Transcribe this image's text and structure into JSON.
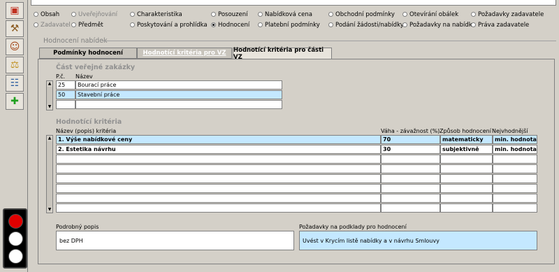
{
  "radios": {
    "row1": [
      {
        "label": "Obsah",
        "style": "normal"
      },
      {
        "label": "Uveřejňování",
        "style": "gray"
      },
      {
        "label": "Charakteristika",
        "style": "normal"
      },
      {
        "label": "Posouzení",
        "style": "normal"
      },
      {
        "label": "Nabídková cena",
        "style": "normal"
      },
      {
        "label": "Obchodní podmínky",
        "style": "normal"
      },
      {
        "label": "Otevírání obálek",
        "style": "normal"
      },
      {
        "label": "Požadavky zadavatele",
        "style": "normal"
      }
    ],
    "row2": [
      {
        "label": "Zadavatel",
        "style": "gray"
      },
      {
        "label": "Předmět",
        "style": "normal"
      },
      {
        "label": "Poskytování a prohlídka",
        "style": "normal"
      },
      {
        "label": "Hodnocení",
        "style": "selected"
      },
      {
        "label": "Platební podmínky",
        "style": "normal"
      },
      {
        "label": "Podání žádosti/nabídky",
        "style": "normal"
      },
      {
        "label": "Požadavky na nabídku",
        "style": "normal"
      },
      {
        "label": "Práva zadavatele",
        "style": "normal"
      }
    ]
  },
  "section_title": "Hodnocení nabídek",
  "tabs": [
    "Podmínky hodnocení",
    "Hodnotící kritéria pro VZ",
    "Hodnotící kritéria pro části VZ"
  ],
  "parts": {
    "title": "Část veřejné zakázky",
    "col_pc": "P.č.",
    "col_name": "Název",
    "rows": [
      {
        "pc": "25",
        "name": "Bourací práce"
      },
      {
        "pc": "50",
        "name": "Stavební práce"
      },
      {
        "pc": "",
        "name": ""
      }
    ]
  },
  "criteria": {
    "title": "Hodnotící kritéria",
    "col_name": "Název (popis) kritéria",
    "col_weight": "Váha - závažnost (%)",
    "col_method": "Způsob hodnocení",
    "col_best": "Nejvhodnější",
    "rows": [
      {
        "name": "1.  Výše nabídkové ceny",
        "weight": "70",
        "method": "matematicky",
        "best": "min. hodnota"
      },
      {
        "name": "2.  Estetika návrhu",
        "weight": "30",
        "method": "subjektivně",
        "best": "min. hodnota"
      },
      {
        "name": "",
        "weight": "",
        "method": "",
        "best": ""
      },
      {
        "name": "",
        "weight": "",
        "method": "",
        "best": ""
      },
      {
        "name": "",
        "weight": "",
        "method": "",
        "best": ""
      },
      {
        "name": "",
        "weight": "",
        "method": "",
        "best": ""
      },
      {
        "name": "",
        "weight": "",
        "method": "",
        "best": ""
      },
      {
        "name": "",
        "weight": "",
        "method": "",
        "best": ""
      }
    ]
  },
  "detail": {
    "label": "Podrobný popis",
    "value": "bez DPH"
  },
  "requirements": {
    "label": "Požadavky na podklady pro hodnocení",
    "value": "Uvést v Krycím listě nabídky a v návrhu Smlouvy"
  },
  "sidebar_icons": [
    "briefcase-icon",
    "hammer-icon",
    "person-icon",
    "scales-icon",
    "document-icon",
    "document-add-icon"
  ],
  "colors": {
    "highlight": "#c4e8ff",
    "red": "#e00000",
    "white": "#ffffff"
  }
}
